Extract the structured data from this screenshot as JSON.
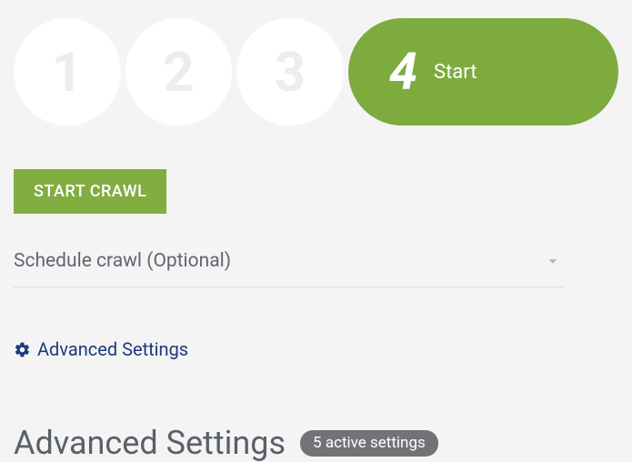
{
  "steps": {
    "inactive": [
      "1",
      "2",
      "3"
    ],
    "active": {
      "num": "4",
      "label": "Start"
    }
  },
  "startButton": "START CRAWL",
  "scheduleRow": "Schedule crawl (Optional)",
  "advancedLink": "Advanced Settings",
  "advancedHeader": {
    "title": "Advanced Settings",
    "badge": "5 active settings"
  }
}
